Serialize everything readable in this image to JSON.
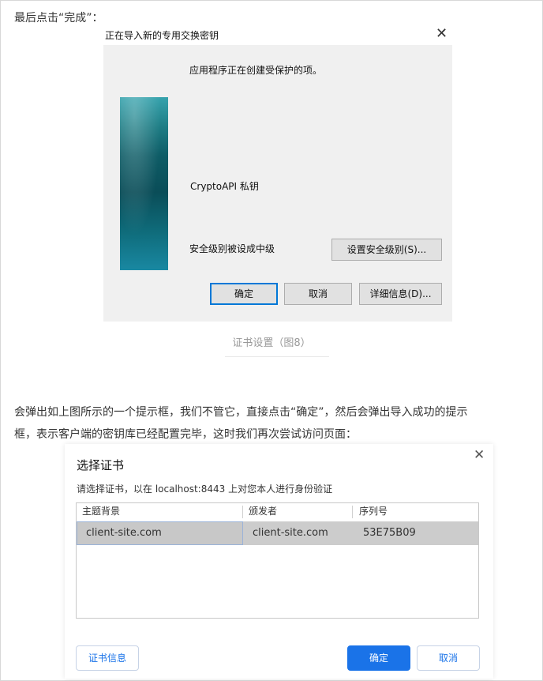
{
  "article": {
    "intro": "最后点击“完成”：",
    "caption": "证书设置（图8）",
    "paragraph_line1": "会弹出如上图所示的一个提示框，我们不管它，直接点击“确定”，然后会弹出导入成功的提示",
    "paragraph_line2": "框，表示客户端的密钥库已经配置完毕，这时我们再次尝试访问页面："
  },
  "import_dialog": {
    "title": "正在导入新的专用交换密钥",
    "close_glyph": "✕",
    "message": "应用程序正在创建受保护的项。",
    "key_label": "CryptoAPI 私钥",
    "security_level_text": "安全级别被设成中级",
    "set_level_button": "设置安全级别(S)...",
    "ok_button": "确定",
    "cancel_button": "取消",
    "details_button": "详细信息(D)..."
  },
  "cert_dialog": {
    "title": "选择证书",
    "close_glyph": "✕",
    "subtitle": "请选择证书，以在 localhost:8443 上对您本人进行身份验证",
    "columns": [
      "主题背景",
      "颁发者",
      "序列号"
    ],
    "rows": [
      {
        "subject": "client-site.com",
        "issuer": "client-site.com",
        "serial": "53E75B09"
      }
    ],
    "cert_info_button": "证书信息",
    "ok_button": "确定",
    "cancel_button": "取消",
    "accent_color": "#1a73e8"
  }
}
